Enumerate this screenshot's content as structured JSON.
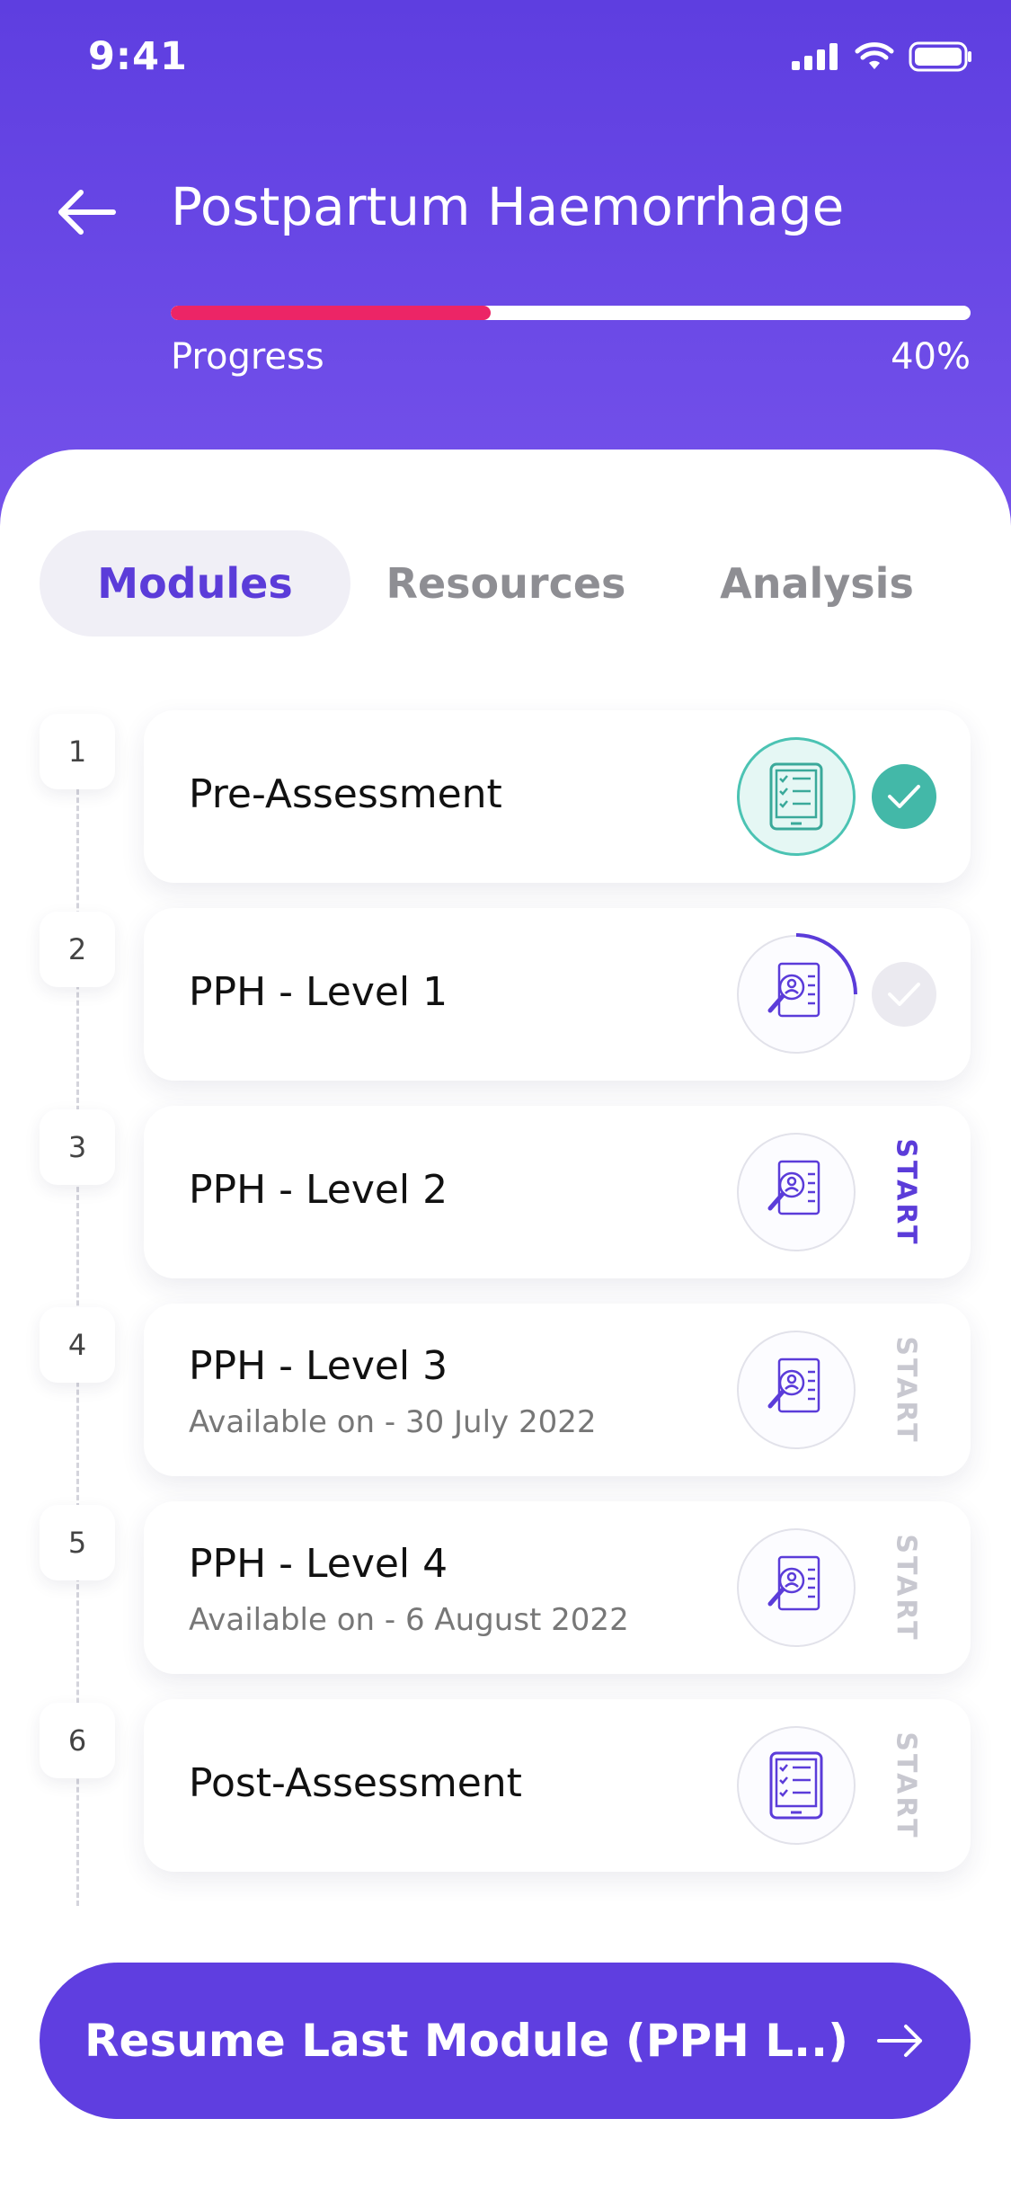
{
  "status_bar": {
    "time": "9:41"
  },
  "header": {
    "title": "Postpartum Haemorrhage",
    "progress_label": "Progress",
    "progress_value": "40%",
    "progress_fraction": 0.4
  },
  "tabs": [
    {
      "label": "Modules",
      "active": true
    },
    {
      "label": "Resources",
      "active": false
    },
    {
      "label": "Analysis",
      "active": false
    }
  ],
  "modules": [
    {
      "number": "1",
      "title": "Pre-Assessment",
      "subtitle": "",
      "status": "completed",
      "icon": "checklist-tablet-icon"
    },
    {
      "number": "2",
      "title": "PPH - Level 1",
      "subtitle": "",
      "status": "in-progress",
      "icon": "profile-search-icon"
    },
    {
      "number": "3",
      "title": "PPH - Level 2",
      "subtitle": "",
      "status": "available",
      "action": "START",
      "icon": "profile-search-icon"
    },
    {
      "number": "4",
      "title": "PPH - Level 3",
      "subtitle": "Available on - 30 July 2022",
      "status": "locked",
      "action": "START",
      "icon": "profile-search-icon"
    },
    {
      "number": "5",
      "title": "PPH - Level 4",
      "subtitle": "Available on - 6 August 2022",
      "status": "locked",
      "action": "START",
      "icon": "profile-search-icon"
    },
    {
      "number": "6",
      "title": "Post-Assessment",
      "subtitle": "",
      "status": "locked",
      "action": "START",
      "icon": "checklist-tablet-icon"
    }
  ],
  "cta": {
    "label": "Resume Last Module (PPH L..)"
  },
  "colors": {
    "primary": "#5f3ee0",
    "accent_pink": "#ec2566",
    "teal": "#4bc3b3",
    "muted": "#c4c4cc"
  }
}
